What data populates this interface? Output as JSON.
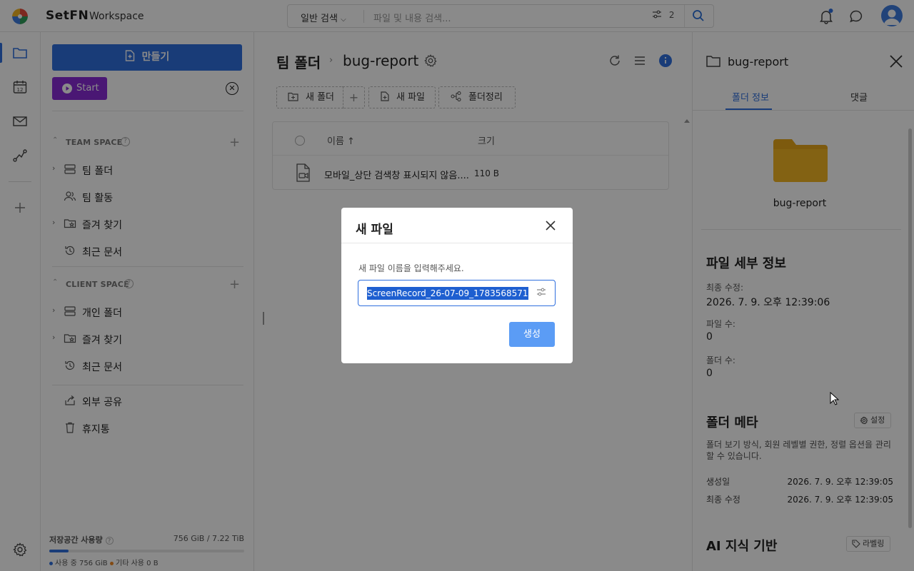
{
  "header": {
    "brand": "SetFN",
    "workspace": "Workspace",
    "search_type": "일반 검색",
    "search_placeholder": "파일 및 내용 검색...",
    "filter_count": "2"
  },
  "sidebar": {
    "create_label": "만들기",
    "start_label": "Start",
    "team_space_title": "TEAM SPACE",
    "team_items": [
      {
        "label": "팀 폴더"
      },
      {
        "label": "팀 활동"
      },
      {
        "label": "즐겨 찾기"
      },
      {
        "label": "최근 문서"
      }
    ],
    "client_space_title": "CLIENT SPACE",
    "client_items": [
      {
        "label": "개인 폴더"
      },
      {
        "label": "즐겨 찾기"
      },
      {
        "label": "최근 문서"
      }
    ],
    "bottom_items": [
      {
        "label": "외부 공유"
      },
      {
        "label": "휴지통"
      }
    ],
    "storage": {
      "title": "저장공간 사용량",
      "value": "756 GiB / 7.22 TiB",
      "fraction": 0.1,
      "used_label": "사용 중 756 GiB",
      "other_label": "기타 사용 0 B",
      "used_color": "#2f6fde",
      "other_color": "#f08a24"
    }
  },
  "main": {
    "breadcrumb_root": "팀 폴더",
    "breadcrumb_current": "bug-report",
    "toolbar": {
      "new_folder": "새 폴더",
      "new_file": "새 파일",
      "organize": "폴더정리"
    },
    "table": {
      "col_name": "이름 ↑",
      "col_size": "크기",
      "rows": [
        {
          "name": "모바일_상단 검색창 표시되지 않음....",
          "size": "110 B"
        }
      ]
    }
  },
  "right_panel": {
    "title": "bug-report",
    "tab_info": "폴더 정보",
    "tab_comments": "댓글",
    "folder_name": "bug-report",
    "details_title": "파일 세부 정보",
    "modified_label": "최종 수정:",
    "modified_value": "2026. 7. 9. 오후 12:39:06",
    "file_count_label": "파일 수:",
    "file_count_value": "0",
    "folder_count_label": "폴더 수:",
    "folder_count_value": "0",
    "meta_title": "폴더 메타",
    "meta_settings": "설정",
    "meta_desc": "폴더 보기 방식, 회원 레벨별 권한, 정렬 옵션을 관리할 수 있습니다.",
    "created_label": "생성일",
    "created_value": "2026. 7. 9. 오후 12:39:05",
    "updated_label": "최종 수정",
    "updated_value": "2026. 7. 9. 오후 12:39:05",
    "ai_title": "AI 지식 기반",
    "ai_labeling": "라벨링"
  },
  "dialog": {
    "title": "새 파일",
    "label": "새 파일 이름을 입력해주세요.",
    "value": "ScreenRecord_26-07-09_1783568571",
    "submit": "생성"
  }
}
